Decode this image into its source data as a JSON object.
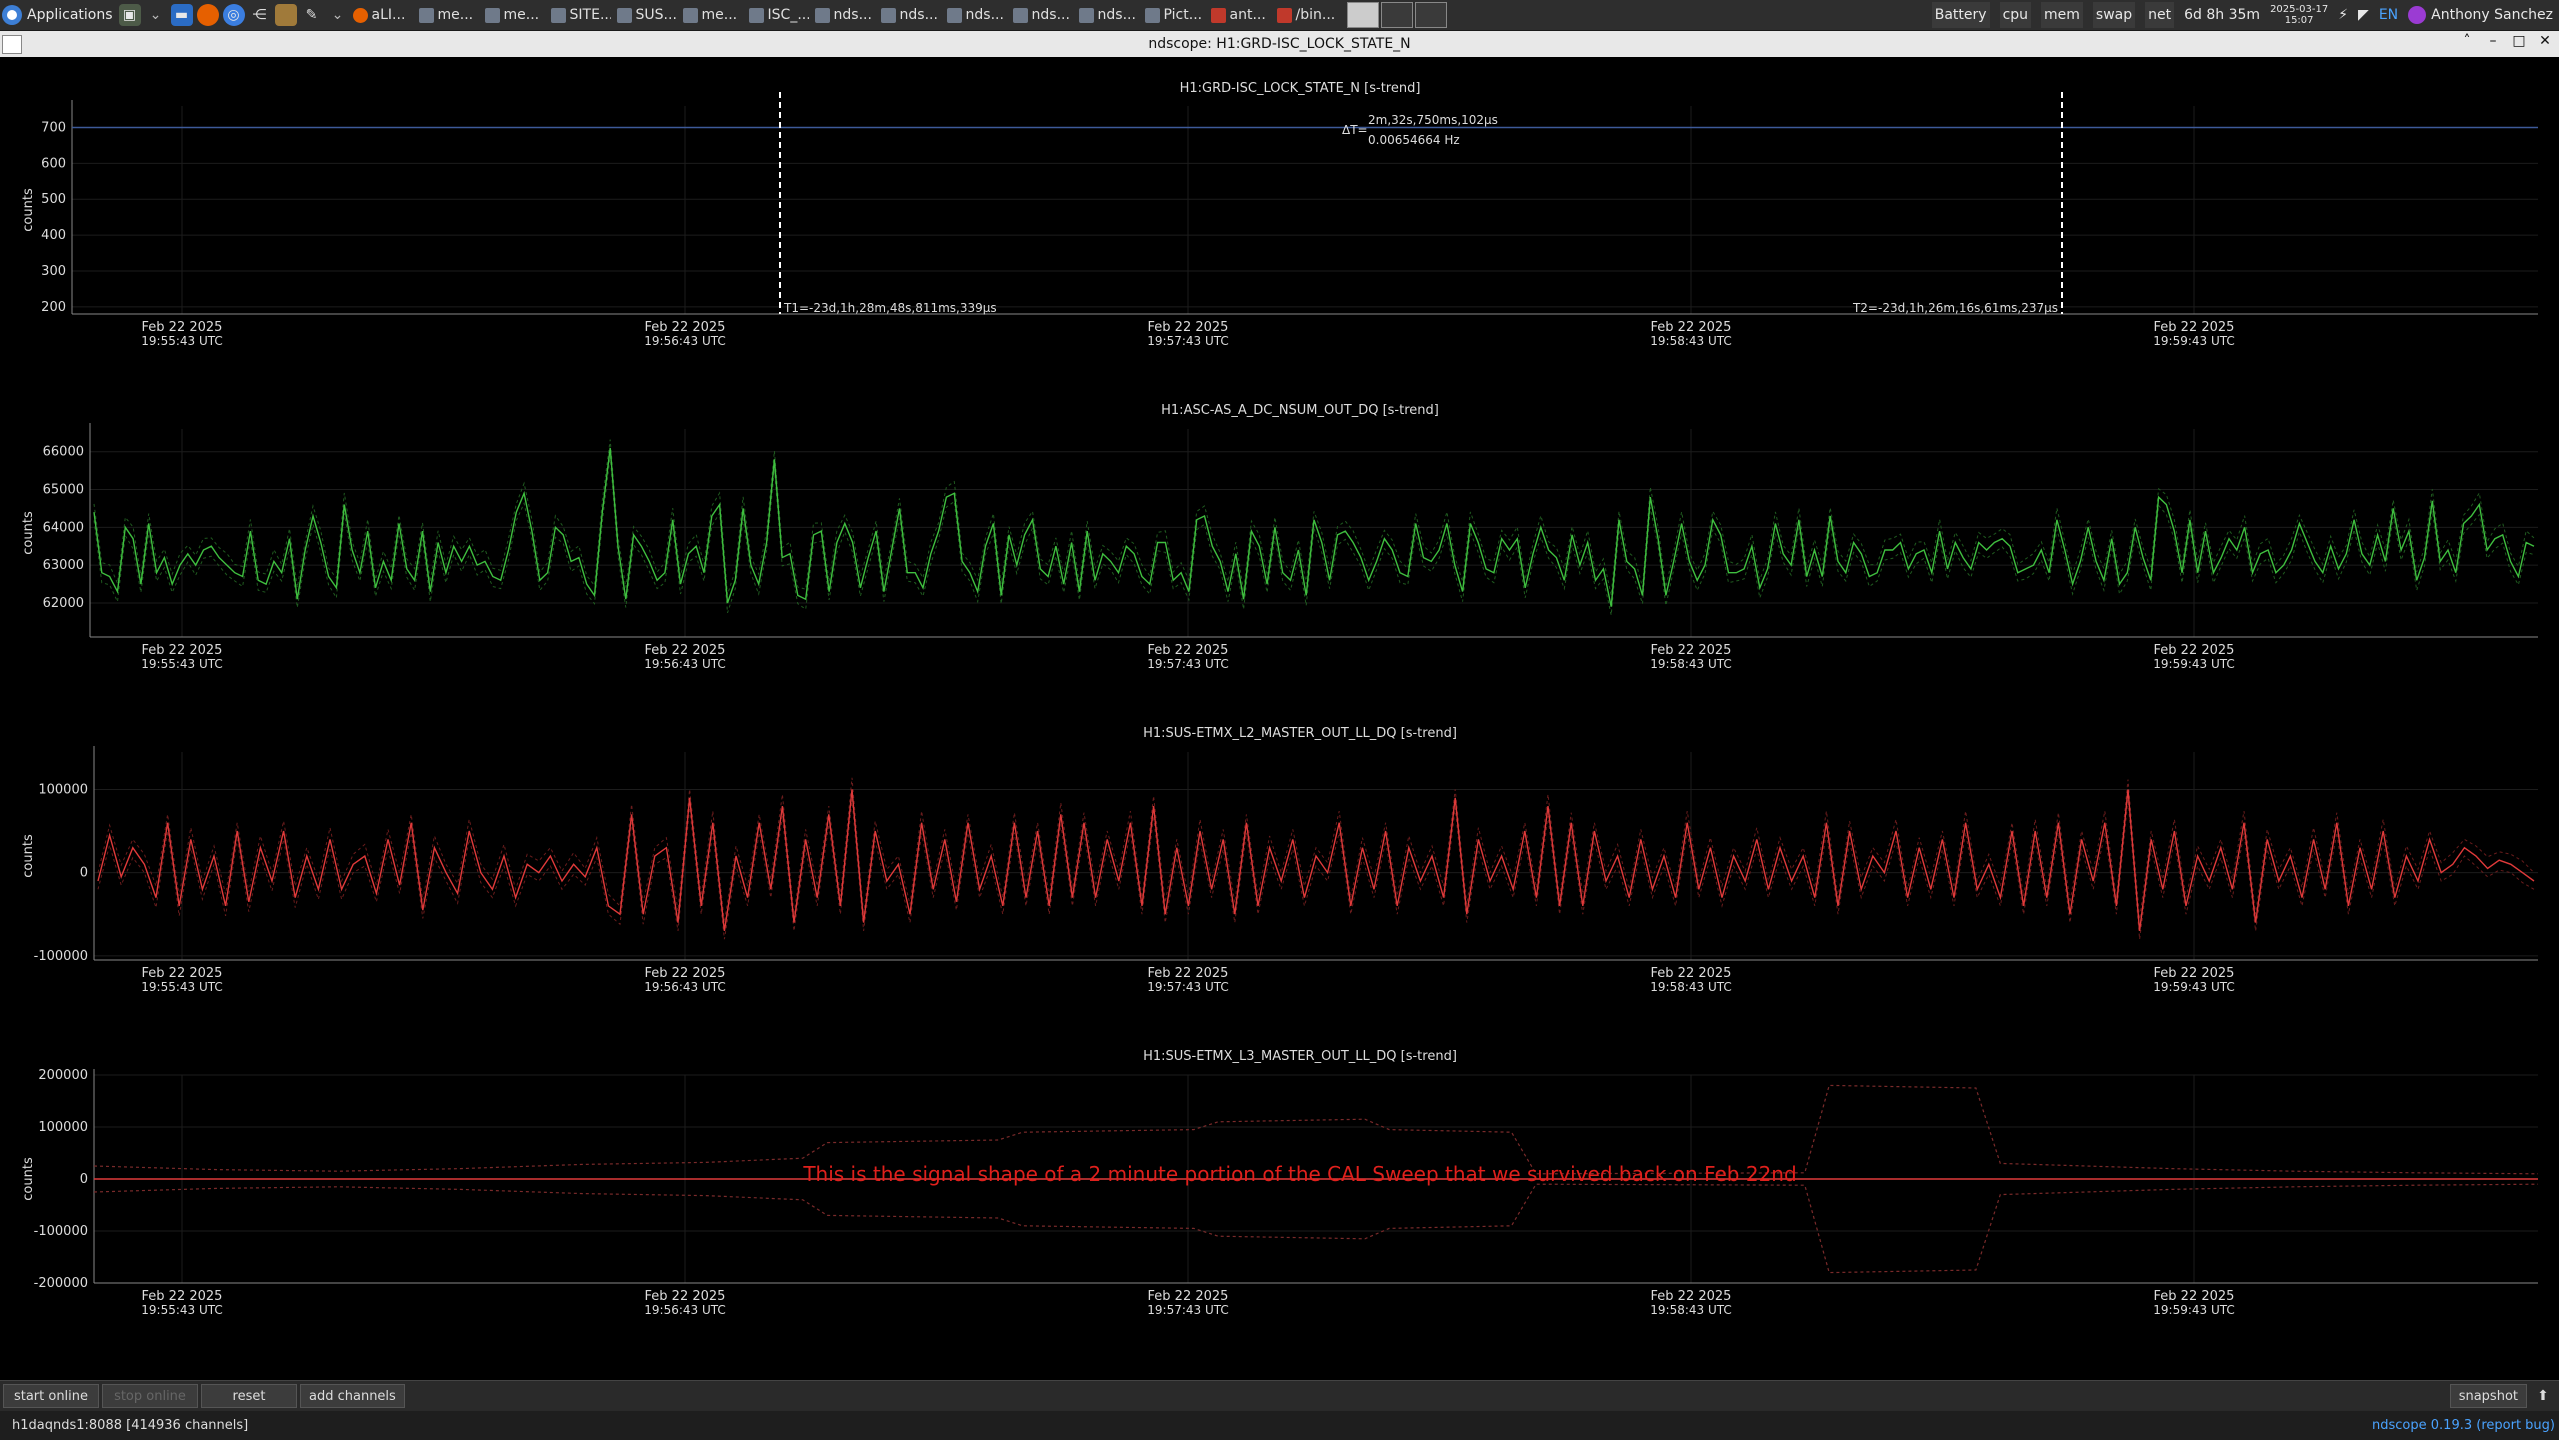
{
  "taskbar": {
    "apps_label": "Applications",
    "tasks": [
      {
        "label": "aLI..."
      },
      {
        "label": "me..."
      },
      {
        "label": "me..."
      },
      {
        "label": "SITE..."
      },
      {
        "label": "SUS..."
      },
      {
        "label": "me..."
      },
      {
        "label": "ISC_..."
      },
      {
        "label": "nds..."
      },
      {
        "label": "nds..."
      },
      {
        "label": "nds..."
      },
      {
        "label": "nds..."
      },
      {
        "label": "nds..."
      },
      {
        "label": "Pict..."
      },
      {
        "label": "ant..."
      },
      {
        "label": "/bin..."
      }
    ],
    "tray": {
      "battery": "Battery",
      "cpu": "cpu",
      "mem": "mem",
      "swap": "swap",
      "net": "net",
      "uptime": "6d 8h 35m",
      "date": "2025-03-17",
      "time": "15:07",
      "lang": "EN",
      "user": "Anthony Sanchez"
    }
  },
  "window": {
    "title": "ndscope: H1:GRD-ISC_LOCK_STATE_N",
    "controls": {
      "collapse": "˄",
      "minimize": "–",
      "maximize": "□",
      "close": "✕"
    }
  },
  "time_axis_labels": [
    {
      "date": "Feb 22 2025",
      "time": "19:55:43 UTC"
    },
    {
      "date": "Feb 22 2025",
      "time": "19:56:43 UTC"
    },
    {
      "date": "Feb 22 2025",
      "time": "19:57:43 UTC"
    },
    {
      "date": "Feb 22 2025",
      "time": "19:58:43 UTC"
    },
    {
      "date": "Feb 22 2025",
      "time": "19:59:43 UTC"
    }
  ],
  "cursors": {
    "t1_label": "T1=-23d,1h,28m,48s,811ms,339μs",
    "t2_label": "T2=-23d,1h,26m,16s,61ms,237μs",
    "delta_prefix": "ΔT=",
    "delta_time": "2m,32s,750ms,102μs",
    "delta_freq": "0.00654664 Hz"
  },
  "annotation": "This is the signal shape of a 2 minute portion of the CAL Sweep that we survived back on Feb 22nd",
  "chart_data": [
    {
      "type": "line",
      "title": "H1:GRD-ISC_LOCK_STATE_N [s-trend]",
      "ylabel": "counts",
      "yticks": [
        200,
        300,
        400,
        500,
        600,
        700
      ],
      "ylim": [
        180,
        760
      ],
      "series": [
        {
          "color": "#3d5a99",
          "x": [
            0,
            300
          ],
          "values": [
            700,
            700
          ]
        }
      ],
      "line_color": "#3d5a99"
    },
    {
      "type": "line",
      "title": "H1:ASC-AS_A_DC_NSUM_OUT_DQ [s-trend]",
      "ylabel": "counts",
      "yticks": [
        62000,
        63000,
        64000,
        65000,
        66000
      ],
      "ylim": [
        61100,
        66600
      ],
      "line_color": "#3fbf3f",
      "values": [
        64400,
        62800,
        62700,
        62300,
        64000,
        63700,
        62500,
        64100,
        62800,
        63200,
        62500,
        63000,
        63300,
        63000,
        63400,
        63500,
        63200,
        63000,
        62800,
        62700,
        63900,
        62600,
        62500,
        63100,
        62800,
        63700,
        62100,
        63400,
        64300,
        63600,
        62700,
        62400,
        64600,
        63400,
        62800,
        63900,
        62400,
        63100,
        62600,
        64100,
        62900,
        62600,
        63900,
        62300,
        63600,
        62800,
        63500,
        63100,
        63500,
        63000,
        63100,
        62700,
        62600,
        63400,
        64400,
        64900,
        63900,
        62600,
        62800,
        64000,
        63800,
        63100,
        63200,
        62500,
        62200,
        64400,
        66100,
        63500,
        62100,
        63800,
        63500,
        63100,
        62600,
        62800,
        64200,
        62500,
        63300,
        63500,
        62800,
        64300,
        64600,
        62000,
        62600,
        64500,
        63000,
        62500,
        63600,
        65800,
        63200,
        63300,
        62200,
        62100,
        63800,
        63900,
        62300,
        63600,
        64100,
        63600,
        62400,
        63200,
        63900,
        62300,
        63400,
        64500,
        62800,
        62800,
        62400,
        63300,
        63900,
        64800,
        64900,
        63100,
        62800,
        62300,
        63500,
        64100,
        62200,
        63800,
        63000,
        63800,
        64200,
        62900,
        62700,
        63500,
        62500,
        63600,
        62300,
        63900,
        62600,
        63300,
        63100,
        62800,
        63500,
        63300,
        62700,
        62500,
        63600,
        63600,
        62600,
        62800,
        62300,
        64200,
        64300,
        63500,
        63100,
        62300,
        63300,
        62100,
        63900,
        63500,
        62500,
        64000,
        62800,
        62600,
        63400,
        62200,
        64200,
        63600,
        62600,
        63800,
        63900,
        63600,
        63200,
        62600,
        63100,
        63700,
        63400,
        62800,
        62700,
        64100,
        63200,
        63100,
        63400,
        64100,
        63000,
        62300,
        64100,
        63600,
        62900,
        62800,
        63700,
        63400,
        63700,
        62400,
        63300,
        64000,
        63400,
        63200,
        62600,
        63800,
        63000,
        63600,
        62600,
        62900,
        61900,
        64200,
        63100,
        62900,
        62200,
        64800,
        63700,
        62200,
        63100,
        64100,
        63100,
        62600,
        63000,
        64200,
        63800,
        62800,
        62800,
        62900,
        63500,
        62400,
        62900,
        64100,
        63300,
        63000,
        64200,
        62700,
        63400,
        62700,
        64300,
        63100,
        62800,
        63600,
        63300,
        62700,
        62800,
        63400,
        63400,
        63600,
        62900,
        63300,
        63400,
        62800,
        63900,
        62900,
        63600,
        63200,
        62900,
        63600,
        63400,
        63600,
        63700,
        63500,
        62800,
        62900,
        63000,
        63400,
        62800,
        64200,
        63400,
        62500,
        63100,
        64000,
        63100,
        62600,
        63700,
        62500,
        62800,
        64000,
        63200,
        62600,
        64800,
        64600,
        63900,
        62800,
        64200,
        62800,
        63900,
        62800,
        63200,
        63700,
        63400,
        64000,
        62800,
        63300,
        63400,
        62800,
        63000,
        63400,
        64100,
        63600,
        63100,
        62800,
        63500,
        62900,
        63300,
        64200,
        63300,
        63000,
        63800,
        63100,
        64500,
        63400,
        63900,
        62600,
        63200,
        64700,
        63100,
        63400,
        62800,
        64100,
        64300,
        64600,
        63400,
        63700,
        63800,
        63100,
        62700,
        63600,
        63500
      ]
    },
    {
      "type": "line",
      "title": "H1:SUS-ETMX_L2_MASTER_OUT_LL_DQ [s-trend]",
      "ylabel": "counts",
      "yticks": [
        -100000,
        0,
        100000
      ],
      "ylim": [
        -105000,
        145000
      ],
      "line_color": "#e03a3a",
      "values": [
        -10000,
        45000,
        -5000,
        30000,
        10000,
        -30000,
        60000,
        -40000,
        40000,
        -20000,
        20000,
        -40000,
        50000,
        -35000,
        30000,
        -10000,
        50000,
        -30000,
        20000,
        -20000,
        40000,
        -20000,
        10000,
        20000,
        -25000,
        40000,
        -15000,
        60000,
        -45000,
        30000,
        0,
        -25000,
        50000,
        0,
        -20000,
        20000,
        -30000,
        10000,
        0,
        20000,
        -10000,
        10000,
        -5000,
        30000,
        -40000,
        -50000,
        70000,
        -50000,
        20000,
        30000,
        -60000,
        90000,
        -40000,
        60000,
        -70000,
        20000,
        -30000,
        60000,
        -20000,
        80000,
        -60000,
        40000,
        -30000,
        70000,
        -40000,
        100000,
        -60000,
        50000,
        -10000,
        10000,
        -50000,
        60000,
        -20000,
        40000,
        -35000,
        60000,
        -20000,
        20000,
        -40000,
        60000,
        -30000,
        50000,
        -40000,
        70000,
        -30000,
        60000,
        -30000,
        40000,
        -10000,
        60000,
        -40000,
        80000,
        -50000,
        30000,
        -40000,
        50000,
        -20000,
        40000,
        -50000,
        60000,
        -40000,
        30000,
        -10000,
        40000,
        -30000,
        20000,
        0,
        60000,
        -40000,
        30000,
        -20000,
        50000,
        -40000,
        30000,
        -10000,
        20000,
        -30000,
        90000,
        -50000,
        40000,
        -10000,
        20000,
        -20000,
        50000,
        -30000,
        80000,
        -40000,
        60000,
        -40000,
        50000,
        -10000,
        20000,
        -30000,
        40000,
        -20000,
        20000,
        -30000,
        60000,
        -20000,
        30000,
        -30000,
        20000,
        -10000,
        40000,
        -20000,
        30000,
        -10000,
        20000,
        -30000,
        60000,
        -40000,
        50000,
        -20000,
        20000,
        0,
        50000,
        -30000,
        30000,
        -20000,
        40000,
        -30000,
        60000,
        -20000,
        10000,
        -30000,
        50000,
        -40000,
        50000,
        -30000,
        60000,
        -50000,
        40000,
        -10000,
        60000,
        -40000,
        100000,
        -70000,
        40000,
        -20000,
        50000,
        -40000,
        20000,
        -10000,
        30000,
        -20000,
        60000,
        -60000,
        40000,
        -10000,
        20000,
        -30000,
        40000,
        -20000,
        60000,
        -40000,
        30000,
        -20000,
        50000,
        -30000,
        20000,
        -10000,
        40000,
        0,
        10000,
        30000,
        20000,
        5000,
        15000,
        10000,
        0,
        -10000
      ]
    },
    {
      "type": "line",
      "title": "H1:SUS-ETMX_L3_MASTER_OUT_LL_DQ [s-trend]",
      "ylabel": "counts",
      "yticks": [
        -200000,
        -100000,
        0,
        100000,
        200000
      ],
      "ylim": [
        -200000,
        200000
      ],
      "line_color": "#e03a3a",
      "values": [
        0,
        0
      ],
      "envelope": [
        [
          0,
          25000
        ],
        [
          0.05,
          18000
        ],
        [
          0.1,
          15000
        ],
        [
          0.15,
          20000
        ],
        [
          0.2,
          28000
        ],
        [
          0.25,
          32000
        ],
        [
          0.29,
          40000
        ],
        [
          0.3,
          70000
        ],
        [
          0.37,
          75000
        ],
        [
          0.38,
          90000
        ],
        [
          0.45,
          95000
        ],
        [
          0.46,
          110000
        ],
        [
          0.52,
          115000
        ],
        [
          0.53,
          95000
        ],
        [
          0.58,
          90000
        ],
        [
          0.59,
          10000
        ],
        [
          0.7,
          12000
        ],
        [
          0.71,
          180000
        ],
        [
          0.77,
          175000
        ],
        [
          0.78,
          30000
        ],
        [
          0.85,
          20000
        ],
        [
          0.9,
          15000
        ],
        [
          0.95,
          12000
        ],
        [
          1.0,
          10000
        ]
      ]
    }
  ],
  "bottom_controls": {
    "start_online": "start online",
    "stop_online": "stop online",
    "reset": "reset",
    "add_channels": "add channels",
    "snapshot": "snapshot",
    "expand_icon": "⬆"
  },
  "status": {
    "server": "h1daqnds1:8088",
    "channels": "[414936 channels]",
    "app_name": "ndscope",
    "version": "0.19.3",
    "report_bug": "(report bug)"
  }
}
